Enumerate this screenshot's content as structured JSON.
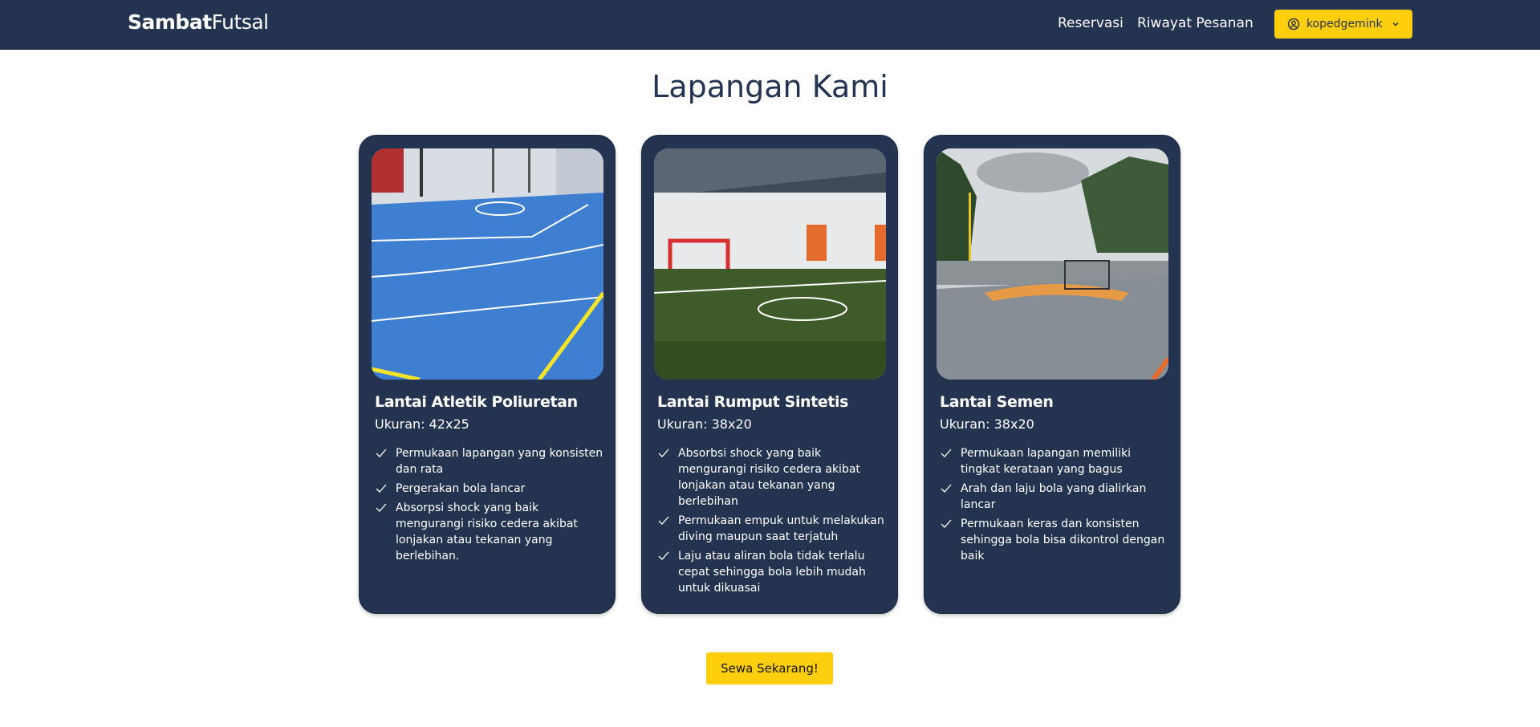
{
  "navbar": {
    "brand_bold": "Sambat",
    "brand_light": "Futsal",
    "links": [
      "Reservasi",
      "Riwayat Pesanan"
    ],
    "user": "kopedgemink",
    "user_icon": "user-circle-icon",
    "dropdown_icon": "chevron-down-icon"
  },
  "page": {
    "title": "Lapangan Kami",
    "cta": "Sewa Sekarang!"
  },
  "colors": {
    "navy": "#233350",
    "accent": "#ffcf0d",
    "white": "#ffffff"
  },
  "cards": [
    {
      "title": "Lantai Atletik Poliuretan",
      "size": "Ukuran: 42x25",
      "features": [
        "Permukaan lapangan yang konsisten dan rata",
        "Pergerakan bola lancar",
        "Absorpsi shock yang baik mengurangi risiko cedera akibat lonjakan atau tekanan yang berlebihan."
      ]
    },
    {
      "title": "Lantai Rumput Sintetis",
      "size": "Ukuran: 38x20",
      "features": [
        "Absorbsi shock yang baik mengurangi risiko cedera akibat lonjakan atau tekanan yang berlebihan",
        "Permukaan empuk untuk melakukan diving maupun saat terjatuh",
        "Laju atau aliran bola tidak terlalu cepat sehingga bola lebih mudah untuk dikuasai"
      ]
    },
    {
      "title": "Lantai Semen",
      "size": "Ukuran: 38x20",
      "features": [
        "Permukaan lapangan memiliki tingkat kerataan yang bagus",
        "Arah dan laju bola yang dialirkan lancar",
        "Permukaan keras dan konsisten sehingga bola bisa dikontrol dengan baik"
      ]
    }
  ]
}
